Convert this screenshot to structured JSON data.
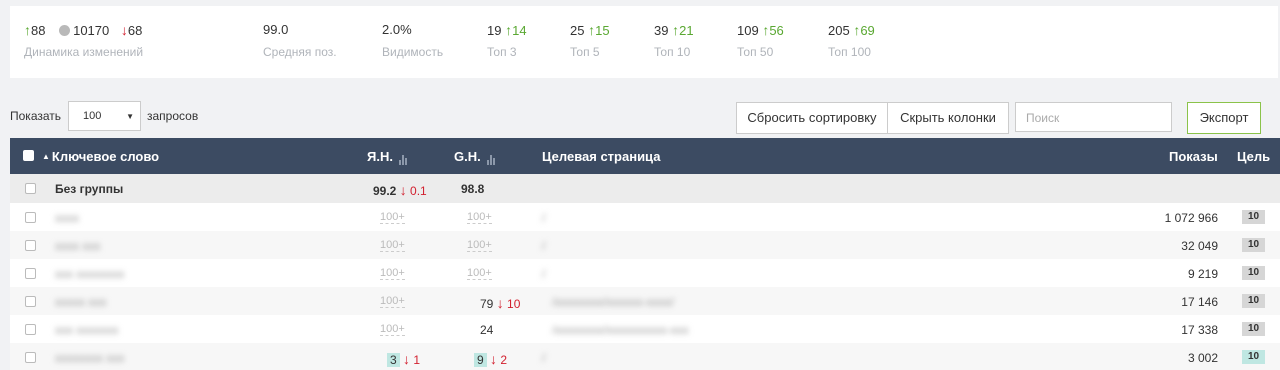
{
  "stats": {
    "dynamics": {
      "up": "88",
      "same": "10170",
      "down": "68",
      "label": "Динамика изменений"
    },
    "avg_pos": {
      "value": "99.0",
      "label": "Средняя поз."
    },
    "visibility": {
      "value": "2.0%",
      "label": "Видимость"
    },
    "top3": {
      "value": "19",
      "delta": "14",
      "label": "Топ 3"
    },
    "top5": {
      "value": "25",
      "delta": "15",
      "label": "Топ 5"
    },
    "top10": {
      "value": "39",
      "delta": "21",
      "label": "Топ 10"
    },
    "top50": {
      "value": "109",
      "delta": "56",
      "label": "Топ 50"
    },
    "top100": {
      "value": "205",
      "delta": "69",
      "label": "Топ 100"
    }
  },
  "controls": {
    "show_label": "Показать",
    "per_page": "100",
    "per_label": "запросов",
    "reset_sort": "Сбросить сортировку",
    "hide_columns": "Скрыть колонки",
    "search_placeholder": "Поиск",
    "export": "Экспорт"
  },
  "table": {
    "headers": {
      "keyword": "Ключевое слово",
      "yandex": "Я.Н.",
      "google": "G.Н.",
      "target": "Целевая страница",
      "impressions": "Показы",
      "goal": "Цель"
    },
    "group": {
      "name": "Без группы",
      "yandex": "99.2",
      "yandex_delta": "0.1",
      "google": "98.8"
    },
    "rows": [
      {
        "keyword": "xxxx",
        "yandex": "100+",
        "google": "100+",
        "page": "/",
        "impressions": "1 072 966",
        "goal": "10"
      },
      {
        "keyword": "xxxx xxx",
        "yandex": "100+",
        "google": "100+",
        "page": "/",
        "impressions": "32 049",
        "goal": "10"
      },
      {
        "keyword": "xxx xxxxxxxx",
        "yandex": "100+",
        "google": "100+",
        "page": "/",
        "impressions": "9 219",
        "goal": "10"
      },
      {
        "keyword": "xxxxx xxx",
        "yandex": "100+",
        "google": "79",
        "google_delta": "10",
        "page": "/xxxxxxxx/xxxxxx-xxxx/",
        "impressions": "17 146",
        "goal": "10"
      },
      {
        "keyword": "xxx xxxxxxx",
        "yandex": "100+",
        "google": "24",
        "page": "/xxxxxxxx/xxxxxxxxxx-xxx",
        "impressions": "17 338",
        "goal": "10"
      },
      {
        "keyword": "xxxxxxxx xxx",
        "yandex": "3",
        "yandex_delta": "1",
        "google": "9",
        "google_delta": "2",
        "page": "/",
        "impressions": "3 002",
        "goal": "10"
      }
    ]
  },
  "colors": {
    "header_bg": "#3c4b62",
    "up": "#5aa832",
    "down": "#d2202f",
    "highlight": "#bfe7e2",
    "export_border": "#8bc34a"
  }
}
